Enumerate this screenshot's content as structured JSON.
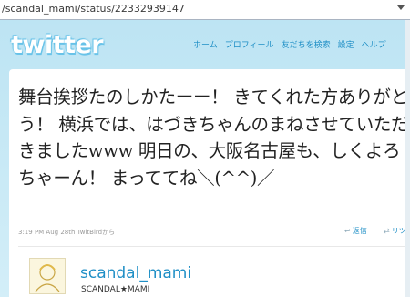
{
  "browser": {
    "url": "/scandal_mami/status/22332939147"
  },
  "header": {
    "logo": "twitter",
    "nav": [
      "ホーム",
      "プロフィール",
      "友だちを検索",
      "設定",
      "ヘルプ"
    ]
  },
  "tweet": {
    "text": "舞台挨拶たのしかたーー！ きてくれた方ありがとう！ 横浜では、はづきちゃんのまねさせていただきましたwww 明日の、大阪名古屋も、しくよろちゃーん！ まっててね＼(^^)／",
    "meta": "3:19 PM Aug 28th TwitBirdから",
    "retweet_label": "返信",
    "reply_label": "リツ"
  },
  "author": {
    "screen_name": "scandal_mami",
    "name": "SCANDAL★MAMI"
  },
  "colors": {
    "link": "#1f8fc6",
    "background": "#c7e9f6"
  }
}
